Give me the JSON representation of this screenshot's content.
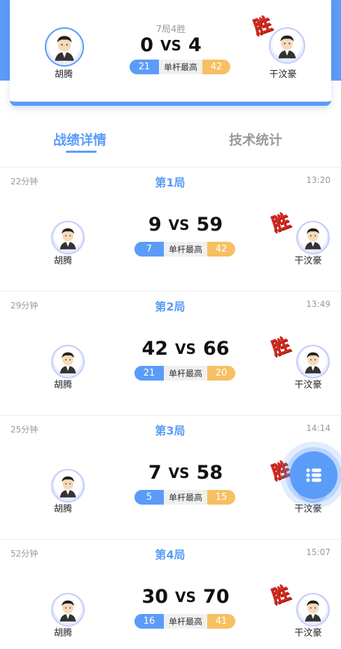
{
  "summary": {
    "format": "7局4胜",
    "left_player": "胡腾",
    "right_player": "干汶豪",
    "left_score": "0",
    "right_score": "4",
    "vs": "VS",
    "max_label": "单杆最高",
    "left_max": "21",
    "right_max": "42",
    "winner_stamp": "胜"
  },
  "tabs": [
    "战绩详情",
    "技术统计"
  ],
  "frames": [
    {
      "title": "第1局",
      "duration": "22分钟",
      "time": "13:20",
      "left_player": "胡腾",
      "right_player": "干汶豪",
      "left_score": "9",
      "right_score": "59",
      "vs": "VS",
      "max_label": "单杆最高",
      "left_max": "7",
      "right_max": "42",
      "winner_stamp": "胜"
    },
    {
      "title": "第2局",
      "duration": "29分钟",
      "time": "13:49",
      "left_player": "胡腾",
      "right_player": "干汶豪",
      "left_score": "42",
      "right_score": "66",
      "vs": "VS",
      "max_label": "单杆最高",
      "left_max": "21",
      "right_max": "20",
      "winner_stamp": "胜"
    },
    {
      "title": "第3局",
      "duration": "25分钟",
      "time": "14:14",
      "left_player": "胡腾",
      "right_player": "干汶豪",
      "left_score": "7",
      "right_score": "58",
      "vs": "VS",
      "max_label": "单杆最高",
      "left_max": "5",
      "right_max": "15",
      "winner_stamp": "胜"
    },
    {
      "title": "第4局",
      "duration": "52分钟",
      "time": "15:07",
      "left_player": "胡腾",
      "right_player": "干汶豪",
      "left_score": "30",
      "right_score": "70",
      "vs": "VS",
      "max_label": "单杆最高",
      "left_max": "16",
      "right_max": "41",
      "winner_stamp": "胜"
    }
  ],
  "icons": {
    "menu": "list-menu-icon",
    "avatar": "player-avatar"
  },
  "colors": {
    "accent": "#5b9cf8",
    "gold": "#f6c063",
    "win": "#d42a1e"
  }
}
